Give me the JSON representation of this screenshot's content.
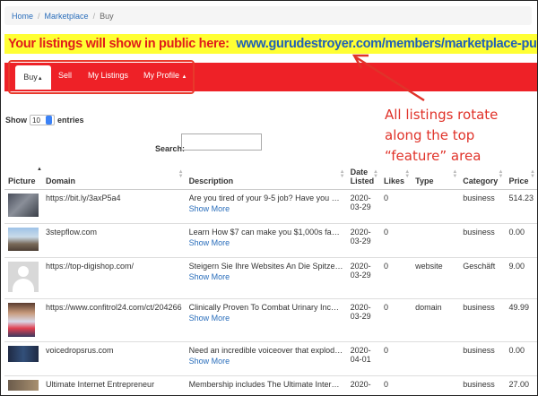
{
  "breadcrumb": {
    "home": "Home",
    "marketplace": "Marketplace",
    "current": "Buy"
  },
  "banner": {
    "lead": "Your listings will show in public here:",
    "url": "www.gurudestroyer.com/members/marketplace-public.php"
  },
  "nav": {
    "buy": "Buy",
    "sell": "Sell",
    "my_listings": "My Listings",
    "my_profile": "My Profile",
    "accent_color": "#ee2127"
  },
  "controls": {
    "show_label": "Show",
    "entries_value": "10",
    "entries_label": "entries",
    "search_label": "Search:"
  },
  "annotation": {
    "lines": [
      "All listings rotate",
      "along the top",
      "“feature” area"
    ],
    "color": "#e0332a"
  },
  "table": {
    "headers": {
      "picture": "Picture",
      "domain": "Domain",
      "description": "Description",
      "date_listed_1": "Date",
      "date_listed_2": "Listed",
      "likes": "Likes",
      "type": "Type",
      "category": "Category",
      "price": "Price"
    },
    "show_more": "Show More",
    "rows": [
      {
        "domain": "https://bit.ly/3axP5a4",
        "description": "Are you tired of your 9-5 job? Have you be...",
        "date1": "2020-",
        "date2": "03-29",
        "likes": "0",
        "type": "",
        "category": "business",
        "price": "514.23"
      },
      {
        "domain": "3stepflow.com",
        "description": "Learn How $7 can make you $1,000s fast...",
        "date1": "2020-",
        "date2": "03-29",
        "likes": "0",
        "type": "",
        "category": "business",
        "price": "0.00"
      },
      {
        "domain": "https://top-digishop.com/",
        "description": "Steigern Sie Ihre Websites An Die Spitze V...",
        "date1": "2020-",
        "date2": "03-29",
        "likes": "0",
        "type": "website",
        "category": "Geschäft",
        "price": "9.00"
      },
      {
        "domain": "https://www.confitrol24.com/ct/204266",
        "description": "Clinically Proven To Combat Urinary Incon...",
        "date1": "2020-",
        "date2": "03-29",
        "likes": "0",
        "type": "domain",
        "category": "business",
        "price": "49.99"
      },
      {
        "domain": "voicedropsrus.com",
        "description": "Need an incredible voiceover that explode...",
        "date1": "2020-",
        "date2": "04-01",
        "likes": "0",
        "type": "",
        "category": "business",
        "price": "0.00"
      },
      {
        "domain": "Ultimate Internet Entrepreneur",
        "description": "Membership includes The Ultimate Interne...",
        "date1": "2020-",
        "date2": "",
        "likes": "0",
        "type": "",
        "category": "business",
        "price": "27.00"
      }
    ]
  }
}
